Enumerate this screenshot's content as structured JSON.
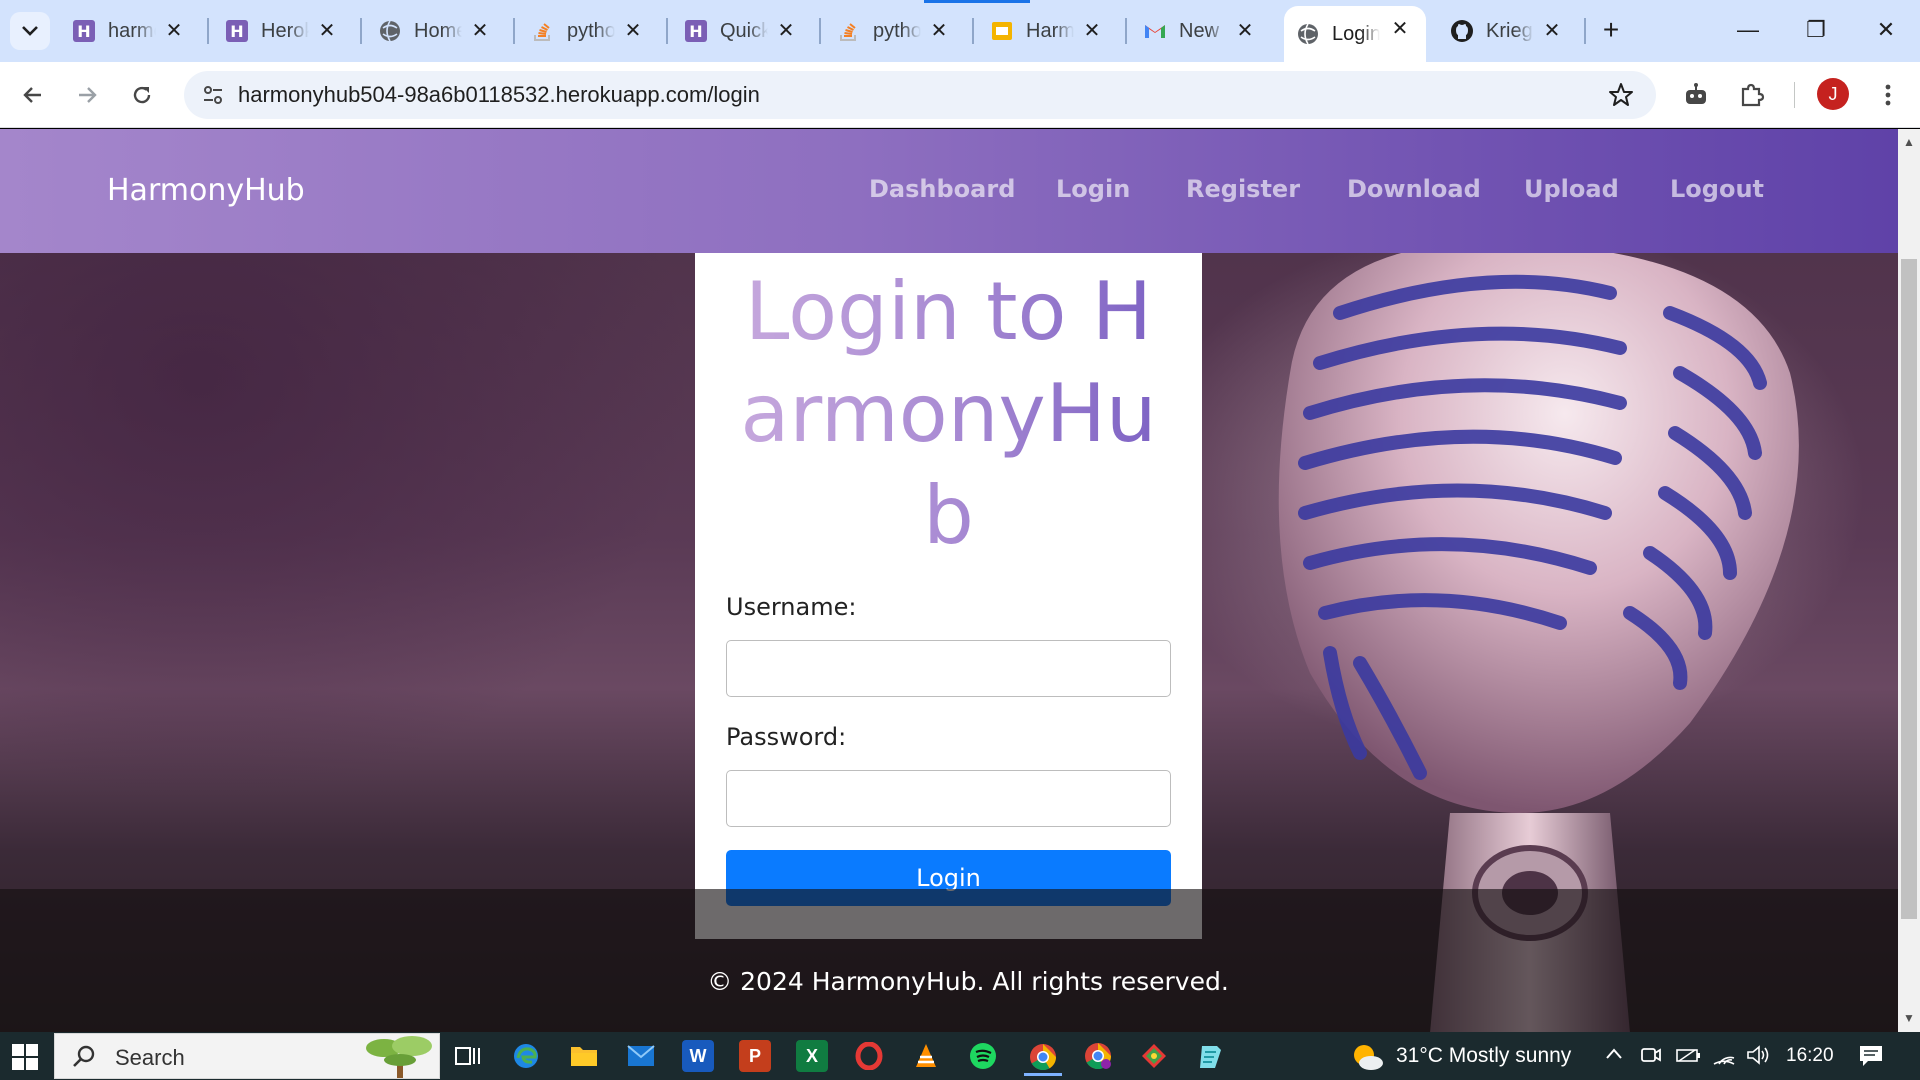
{
  "browser": {
    "tabs": [
      {
        "title": "harmonyhub",
        "icon": "heroku-icon"
      },
      {
        "title": "Heroku",
        "icon": "heroku-icon"
      },
      {
        "title": "Home",
        "icon": "globe-icon"
      },
      {
        "title": "python",
        "icon": "stackoverflow-icon"
      },
      {
        "title": "Quick",
        "icon": "heroku-icon"
      },
      {
        "title": "python",
        "icon": "stackoverflow-icon"
      },
      {
        "title": "Harm",
        "icon": "slides-icon"
      },
      {
        "title": "New",
        "icon": "gmail-icon"
      },
      {
        "title": "Login",
        "icon": "globe-icon",
        "active": true
      },
      {
        "title": "Krieg",
        "icon": "github-icon"
      }
    ],
    "url": "harmonyhub504-98a6b0118532.herokuapp.com/login",
    "profile_initial": "J"
  },
  "page": {
    "brand": "HarmonyHub",
    "nav": [
      "Dashboard",
      "Login",
      "Register",
      "Download",
      "Upload",
      "Logout"
    ],
    "login_title": "Login to HarmonyHub",
    "username_label": "Username:",
    "username_value": "",
    "password_label": "Password:",
    "password_value": "",
    "login_button": "Login",
    "footer": "© 2024 HarmonyHub. All rights reserved."
  },
  "taskbar": {
    "search_placeholder": "Search",
    "weather": "31°C  Mostly sunny",
    "time": "16:20"
  },
  "colors": {
    "nav_start": "#a486cb",
    "nav_end": "#5f42a8",
    "login_button": "#0a7bff"
  }
}
